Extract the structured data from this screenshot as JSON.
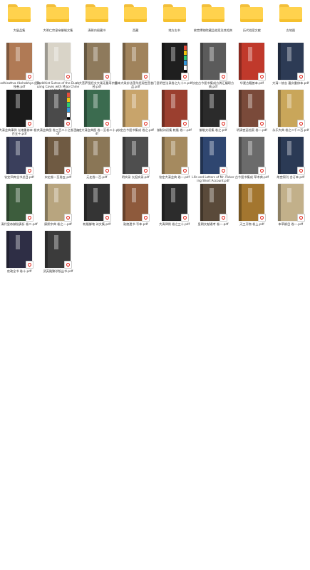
{
  "folders": [
    {
      "name": "大展品集"
    },
    {
      "name": "大明仁宗皇帝御制文集"
    },
    {
      "name": "清朝内阁藏书"
    },
    {
      "name": "西藏"
    },
    {
      "name": "地方志书"
    },
    {
      "name": "故宫博物院藏品档案及其相关"
    },
    {
      "name": "历代档案文献"
    },
    {
      "name": "古地图"
    }
  ],
  "files": [
    {
      "name": "Bodhisattva Akshobhya 经文残卷.pdf",
      "color": "#b07a55",
      "ruler": false
    },
    {
      "name": "Buddhist Sutras of the Dunhuang Caves with Miao Chinese text.pdf",
      "color": "#d9d4c8",
      "ruler": false
    },
    {
      "name": "八大菩萨图经文大乘无量寿宗要经.pdf",
      "color": "#8e7a5c",
      "ruler": false
    },
    {
      "name": "古本大乘妙法莲华经观世音普门品.pdf",
      "color": "#a0835c",
      "ruler": false
    },
    {
      "name": "皇明世法录卷之九十二.pdf",
      "color": "#1f1f1f",
      "ruler": true
    },
    {
      "name": "钦定古今图书集成方舆汇编职方典.pdf",
      "color": "#5b5b5b",
      "ruler": false
    },
    {
      "name": "华夏古籍善本.pdf",
      "color": "#c0392b",
      "ruler": false
    },
    {
      "name": "大清一统志 嘉庆重修本.pdf",
      "color": "#2d3b55",
      "ruler": false
    },
    {
      "name": "大清会典事例 光绪重修本 卷一百五十.pdf",
      "color": "#1b1b1b",
      "ruler": false
    },
    {
      "name": "大清会典图 卷三百二十之卷百.pdf",
      "color": "#4a4a4a",
      "ruler": true
    },
    {
      "name": "钦定大清会典图 卷一至卷二十.pdf",
      "color": "#3b6b4f",
      "ruler": false
    },
    {
      "name": "钦定古今图书集成 卷之.pdf",
      "color": "#c8a46b",
      "ruler": false
    },
    {
      "name": "御制诗初集 乾隆 卷一.pdf",
      "color": "#9b3f2f",
      "ruler": false
    },
    {
      "name": "御制文初集 卷之.pdf",
      "color": "#2b2b2b",
      "ruler": false
    },
    {
      "name": "明清宫廷档案 卷一.pdf",
      "color": "#7a4a3a",
      "ruler": false
    },
    {
      "name": "永乐大典 卷之二千二百.pdf",
      "color": "#c9a65a",
      "ruler": false
    },
    {
      "name": "钦定四库全书总目.pdf",
      "color": "#3a3f5c",
      "ruler": false
    },
    {
      "name": "宋史卷一至卷五.pdf",
      "color": "#6f5a42",
      "ruler": false
    },
    {
      "name": "元史卷一百.pdf",
      "color": "#8a7656",
      "ruler": false
    },
    {
      "name": "明实录 太祖实录.pdf",
      "color": "#4e4e4e",
      "ruler": false
    },
    {
      "name": "钦定大清会典 卷一.pdf",
      "color": "#a58a5f",
      "ruler": false
    },
    {
      "name": "Life and Letters of Mr. Pickering Short Account.pdf",
      "color": "#2f4670",
      "ruler": false
    },
    {
      "name": "古今图书集成 草木典.pdf",
      "color": "#6b6b6b",
      "ruler": false
    },
    {
      "name": "故宫周刊 合订本.pdf",
      "color": "#2b3a55",
      "ruler": false
    },
    {
      "name": "清代皇帝御批奏折 卷二.pdf",
      "color": "#3d5d3d",
      "ruler": false
    },
    {
      "name": "康熙字典 卷之一.pdf",
      "color": "#b8a57f",
      "ruler": false
    },
    {
      "name": "乾隆御笔 诗文集.pdf",
      "color": "#343434",
      "ruler": false
    },
    {
      "name": "敦煌遗书 写本.pdf",
      "color": "#8e5a3c",
      "ruler": false
    },
    {
      "name": "大清律例 卷之三十.pdf",
      "color": "#2c2c2c",
      "ruler": false
    },
    {
      "name": "皇朝文献通考 卷一.pdf",
      "color": "#5a4a3a",
      "ruler": false
    },
    {
      "name": "天工开物 卷上.pdf",
      "color": "#a3762f",
      "ruler": false
    },
    {
      "name": "本草纲目 卷一.pdf",
      "color": "#c2b08a",
      "ruler": false
    },
    {
      "name": "农政全书 卷十.pdf",
      "color": "#2e2e45",
      "ruler": false
    },
    {
      "name": "武英殿聚珍版丛书.pdf",
      "color": "#3b3b3b",
      "ruler": false
    }
  ]
}
